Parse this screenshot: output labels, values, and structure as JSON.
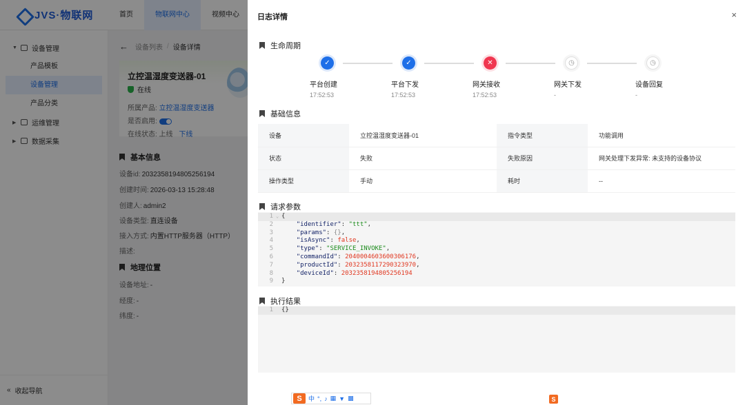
{
  "app": {
    "logo_text": "JVS·物联网"
  },
  "topnav": [
    "首页",
    "物联网中心",
    "视频中心"
  ],
  "sidebar": {
    "group_device": "设备管理",
    "items": [
      "产品模板",
      "设备管理",
      "产品分类"
    ],
    "group_ops": "运维管理",
    "group_data": "数据采集",
    "collapse": "收起导航"
  },
  "breadcrumb": {
    "list": "设备列表",
    "sep": "/",
    "current": "设备详情"
  },
  "device": {
    "name": "立控温湿度变送器-01",
    "status": "在线",
    "product_label": "所属产品:",
    "product_value": "立控温湿度变送器",
    "enabled_label": "是否启用:",
    "online_label": "在线状态: 上线",
    "offline_link": "下线"
  },
  "basic": {
    "title": "基本信息",
    "rows": [
      {
        "k": "设备id:",
        "v": "2032358194805256194"
      },
      {
        "k": "创建时间:",
        "v": "2026-03-13 15:28:48"
      },
      {
        "k": "创建人:",
        "v": "admin2"
      },
      {
        "k": "设备类型:",
        "v": "直连设备"
      },
      {
        "k": "接入方式:",
        "v": "内置HTTP服务器（HTTP）"
      },
      {
        "k": "描述:",
        "v": ""
      }
    ]
  },
  "geo": {
    "title": "地理位置",
    "rows": [
      {
        "k": "设备地址:",
        "v": "-"
      },
      {
        "k": "经度:",
        "v": "-"
      },
      {
        "k": "纬度:",
        "v": "-"
      }
    ]
  },
  "drawer": {
    "title": "日志详情",
    "close": "×",
    "lifecycle_title": "生命周期",
    "steps": [
      {
        "label": "平台创建",
        "time": "17:52:53",
        "state": "done",
        "glyph": "✓"
      },
      {
        "label": "平台下发",
        "time": "17:52:53",
        "state": "done",
        "glyph": "✓"
      },
      {
        "label": "网关接收",
        "time": "17:52:53",
        "state": "fail",
        "glyph": "✕"
      },
      {
        "label": "网关下发",
        "time": "-",
        "state": "wait",
        "glyph": "◷"
      },
      {
        "label": "设备回复",
        "time": "-",
        "state": "wait",
        "glyph": "◷"
      }
    ],
    "info_title": "基础信息",
    "info": [
      [
        "设备",
        "立控温湿度变送器-01",
        "指令类型",
        "功能调用"
      ],
      [
        "状态",
        "失败",
        "失败原因",
        "网关处理下发异常: 未支持的设备协议"
      ],
      [
        "操作类型",
        "手动",
        "耗时",
        "--"
      ]
    ],
    "request_title": "请求参数",
    "request_lines": [
      {
        "n": "1",
        "fold": "⌄",
        "t": "{"
      },
      {
        "n": "2",
        "key": "\"identifier\"",
        "val": "\"ttt\"",
        "vt": "s",
        "end": ","
      },
      {
        "n": "3",
        "key": "\"params\"",
        "val": "{}",
        "vt": "o",
        "end": ","
      },
      {
        "n": "4",
        "key": "\"isAsync\"",
        "val": "false",
        "vt": "b",
        "end": ","
      },
      {
        "n": "5",
        "key": "\"type\"",
        "val": "\"SERVICE_INVOKE\"",
        "vt": "s",
        "end": ","
      },
      {
        "n": "6",
        "key": "\"commandId\"",
        "val": "2040004603600306176",
        "vt": "n",
        "end": ","
      },
      {
        "n": "7",
        "key": "\"productId\"",
        "val": "2032358117290323970",
        "vt": "n",
        "end": ","
      },
      {
        "n": "8",
        "key": "\"deviceId\"",
        "val": "2032358194805256194",
        "vt": "n",
        "end": ""
      },
      {
        "n": "9",
        "t": "}"
      }
    ],
    "result_title": "执行结果",
    "result_lines": [
      {
        "n": "1",
        "t": "{}"
      }
    ]
  },
  "ime": {
    "cn": "中",
    "s": "S"
  },
  "colors": {
    "primary": "#1e6fe8",
    "fail": "#f0364f",
    "string": "#1a8a1a",
    "number": "#e0361f"
  }
}
